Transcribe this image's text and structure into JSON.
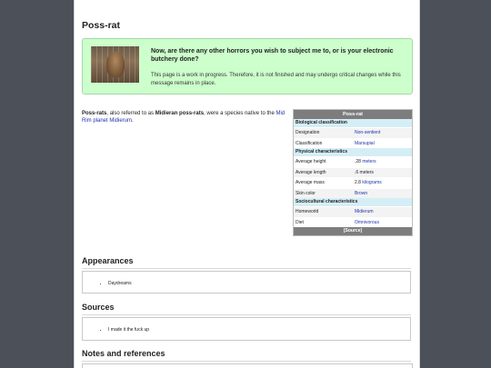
{
  "page": {
    "title": "Poss-rat"
  },
  "notice": {
    "heading": "Now, are there any other horrors you wish to subject me to, or is your electronic butchery done?",
    "body": "This page is a work in progress. Therefore, it is not finished and may undergo critical changes while this message remains in place."
  },
  "intro": {
    "name": "Poss-rats",
    "text1": ", also referred to as ",
    "alt_name": "Midieran poss-rats",
    "text2": ", were a species native to the ",
    "link": "Mid Rim planet Midierum",
    "text3": "."
  },
  "infobox": {
    "title": "Poss-rat",
    "sections": [
      {
        "heading": "Biological classification",
        "rows": [
          {
            "label": "Designation",
            "value": "Non-sentient",
            "link": true
          },
          {
            "label": "Classification",
            "value": "Marsupial",
            "link": true
          }
        ]
      },
      {
        "heading": "Physical characteristics",
        "rows": [
          {
            "label": "Average height",
            "value": ".28 ",
            "unit": "meters"
          },
          {
            "label": "Average length",
            "value": ".6 meters",
            "unit": ""
          },
          {
            "label": "Average mass",
            "value": "2.8 ",
            "unit": "kilograms"
          },
          {
            "label": "Skin color",
            "value": "Brown",
            "link": true
          }
        ]
      },
      {
        "heading": "Sociocultural characteristics",
        "rows": [
          {
            "label": "Homeworld",
            "value": "Midierum",
            "link": true
          },
          {
            "label": "Diet",
            "value": "Omnivorous",
            "link": true
          }
        ]
      }
    ],
    "footer": "[Source]"
  },
  "appearances": {
    "heading": "Appearances",
    "items": [
      "Daydreams"
    ]
  },
  "sources": {
    "heading": "Sources",
    "items": [
      "I made it the fuck up"
    ]
  },
  "notes": {
    "heading": "Notes and references"
  }
}
